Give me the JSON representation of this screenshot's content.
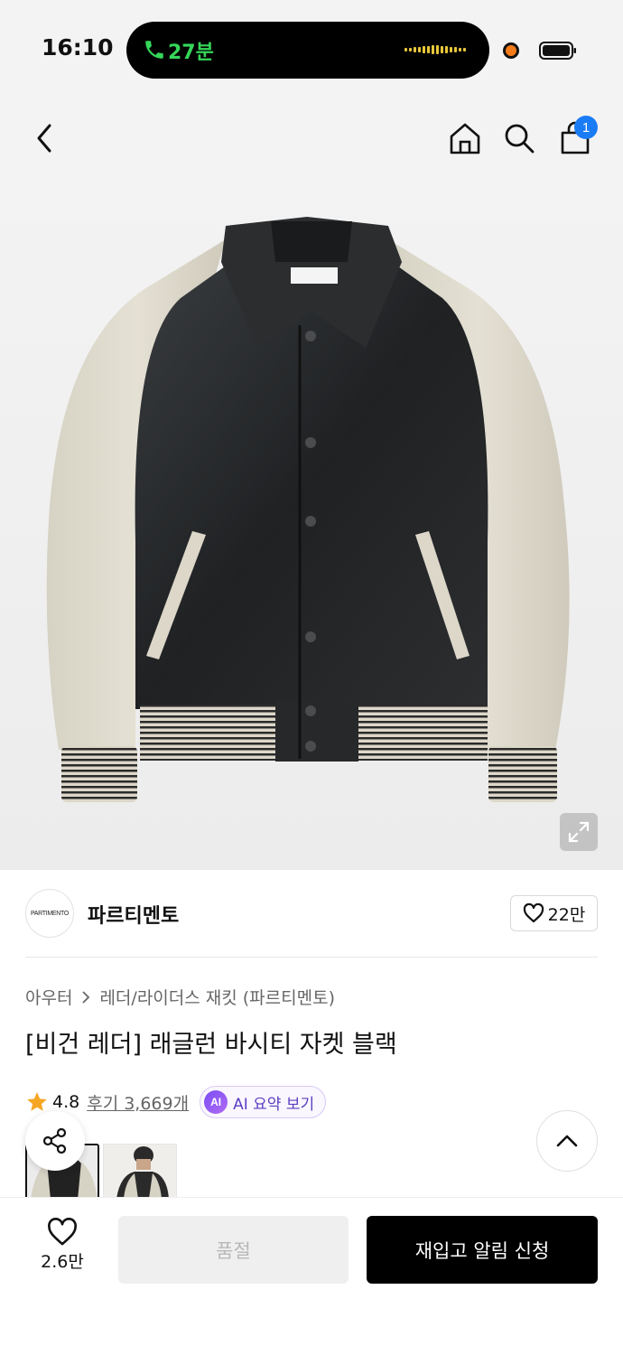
{
  "status_bar": {
    "time": "16:10",
    "call_duration": "27분"
  },
  "nav": {
    "cart_count": "1",
    "icons": [
      "chevron-left-icon",
      "home-icon",
      "search-icon",
      "shopping-bag-icon"
    ]
  },
  "brand": {
    "logo_text": "PARTIMENTO",
    "name": "파르티멘토",
    "likes": "22만"
  },
  "product": {
    "category_main": "아우터",
    "category_sub": "레더/라이더스 재킷 (파르티멘토)",
    "title": "[비건 레더] 래글런 바시티 자켓 블랙",
    "rating": "4.8",
    "reviews_label": "후기 3,669개",
    "ai_badge": "AI",
    "ai_summary_label": "AI 요약 보기"
  },
  "bottom_bar": {
    "wish_count": "2.6만",
    "soldout_label": "품절",
    "restock_label": "재입고 알림 신청"
  },
  "colors": {
    "accent_blue": "#1a7cf5",
    "call_green": "#35d65a",
    "star": "#f5a623",
    "ai_purple": "#7a4df3"
  }
}
